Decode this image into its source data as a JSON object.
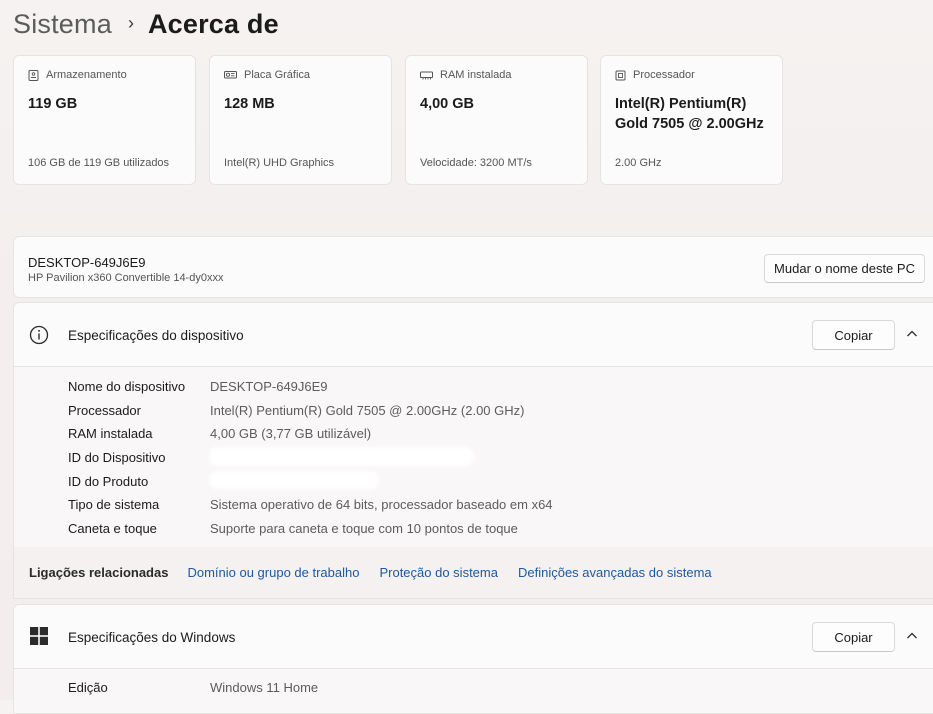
{
  "breadcrumb": {
    "parent": "Sistema",
    "separator": "›",
    "current": "Acerca de"
  },
  "cards": [
    {
      "icon": "storage-icon",
      "title": "Armazenamento",
      "value": "119 GB",
      "sub": "106 GB de 119 GB utilizados"
    },
    {
      "icon": "gpu-icon",
      "title": "Placa Gráfica",
      "value": "128 MB",
      "sub": "Intel(R) UHD Graphics"
    },
    {
      "icon": "ram-icon",
      "title": "RAM instalada",
      "value": "4,00 GB",
      "sub": "Velocidade: 3200 MT/s"
    },
    {
      "icon": "processor-icon",
      "title": "Processador",
      "value": "Intel(R) Pentium(R) Gold 7505 @ 2.00GHz",
      "sub": "2.00 GHz"
    }
  ],
  "device": {
    "name": "DESKTOP-649J6E9",
    "model": "HP Pavilion x360 Convertible 14-dy0xxx",
    "rename_label": "Mudar o nome deste PC"
  },
  "device_specs": {
    "title": "Especificações do dispositivo",
    "copy_label": "Copiar",
    "rows": [
      {
        "label": "Nome do dispositivo",
        "value": "DESKTOP-649J6E9"
      },
      {
        "label": "Processador",
        "value": "Intel(R) Pentium(R) Gold 7505 @ 2.00GHz (2.00 GHz)"
      },
      {
        "label": "RAM instalada",
        "value": "4,00 GB (3,77 GB utilizável)"
      },
      {
        "label": "ID do Dispositivo",
        "value": ""
      },
      {
        "label": "ID do Produto",
        "value": ""
      },
      {
        "label": "Tipo de sistema",
        "value": "Sistema operativo de 64 bits, processador baseado em x64"
      },
      {
        "label": "Caneta e toque",
        "value": "Suporte para caneta e toque com 10 pontos de toque"
      }
    ]
  },
  "related": {
    "label": "Ligações relacionadas",
    "links": [
      "Domínio ou grupo de trabalho",
      "Proteção do sistema",
      "Definições avançadas do sistema"
    ]
  },
  "windows_specs": {
    "title": "Especificações do Windows",
    "copy_label": "Copiar",
    "rows": [
      {
        "label": "Edição",
        "value": "Windows 11 Home"
      }
    ]
  },
  "colors": {
    "link": "#1d5aa0",
    "windows_logo": "#2b2b2b"
  }
}
